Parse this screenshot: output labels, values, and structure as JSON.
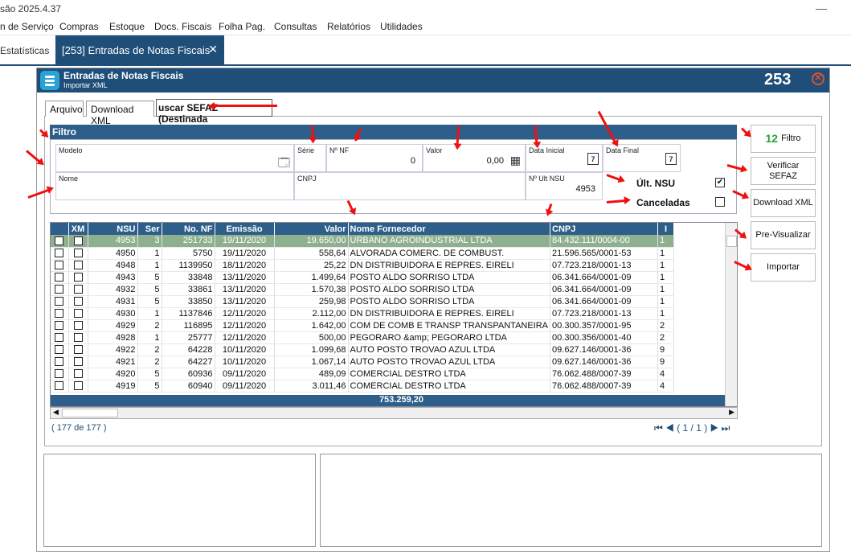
{
  "app": {
    "title_fragment": "são 2025.4.37",
    "minimize": "—"
  },
  "menu": [
    "n de Serviço",
    "Compras",
    "Estoque",
    "Docs. Fiscais",
    "Folha Pag.",
    "Consultas",
    "Relatórios",
    "Utilidades"
  ],
  "tabs": {
    "prev": "Estatísticas",
    "active": "[253] Entradas de Notas Fiscais",
    "close": "✕"
  },
  "window": {
    "title": "Entradas de Notas Fiscais",
    "subtitle": "Importar XML",
    "number": "253",
    "close": "✕"
  },
  "inner_tabs": [
    "Arquivo",
    "Download XML",
    "uscar SEFAZ (Destinada"
  ],
  "filtro": {
    "header": "Filtro",
    "modelo": {
      "label": "Modelo",
      "value": ""
    },
    "serie": {
      "label": "Série",
      "value": ""
    },
    "nnf": {
      "label": "Nº NF",
      "value": "0"
    },
    "valor": {
      "label": "Valor",
      "value": "0,00"
    },
    "data_inicial": {
      "label": "Data Inicial",
      "value": ""
    },
    "data_final": {
      "label": "Data Final",
      "value": ""
    },
    "nome": {
      "label": "Nome",
      "value": ""
    },
    "cnpj": {
      "label": "CNPJ",
      "value": ""
    },
    "ult_nsu": {
      "label": "Nº Ult NSU",
      "value": "4953"
    },
    "chk_ult_nsu": {
      "label": "Últ. NSU",
      "checked": true
    },
    "chk_canceladas": {
      "label": "Canceladas",
      "checked": false
    }
  },
  "buttons": {
    "filtro": "Filtro",
    "filtro_badge": "12",
    "verificar": "Verificar SEFAZ",
    "download": "Download XML",
    "previsualizar": "Pre-Visualizar",
    "importar": "Importar"
  },
  "grid": {
    "headers": [
      "",
      "XM",
      "NSU",
      "Ser",
      "No. NF",
      "Emissão",
      "Valor",
      "Nome Fornecedor",
      "CNPJ",
      "I"
    ],
    "rows": [
      {
        "nsu": "4953",
        "ser": "3",
        "nf": "251733",
        "emissao": "19/11/2020",
        "valor": "19.650,00",
        "fornecedor": "URBANO AGROINDUSTRIAL LTDA",
        "cnpj": "84.432.111/0004-00",
        "x": "1",
        "sel": true
      },
      {
        "nsu": "4950",
        "ser": "1",
        "nf": "5750",
        "emissao": "19/11/2020",
        "valor": "558,64",
        "fornecedor": "ALVORADA COMERC. DE COMBUST.",
        "cnpj": "21.596.565/0001-53",
        "x": "1"
      },
      {
        "nsu": "4948",
        "ser": "1",
        "nf": "1139950",
        "emissao": "18/11/2020",
        "valor": "25,22",
        "fornecedor": "DN DISTRIBUIDORA E REPRES. EIRELI",
        "cnpj": "07.723.218/0001-13",
        "x": "1"
      },
      {
        "nsu": "4943",
        "ser": "5",
        "nf": "33848",
        "emissao": "13/11/2020",
        "valor": "1.499,64",
        "fornecedor": "POSTO ALDO SORRISO LTDA",
        "cnpj": "06.341.664/0001-09",
        "x": "1"
      },
      {
        "nsu": "4932",
        "ser": "5",
        "nf": "33861",
        "emissao": "13/11/2020",
        "valor": "1.570,38",
        "fornecedor": "POSTO ALDO SORRISO LTDA",
        "cnpj": "06.341.664/0001-09",
        "x": "1"
      },
      {
        "nsu": "4931",
        "ser": "5",
        "nf": "33850",
        "emissao": "13/11/2020",
        "valor": "259,98",
        "fornecedor": "POSTO ALDO SORRISO LTDA",
        "cnpj": "06.341.664/0001-09",
        "x": "1"
      },
      {
        "nsu": "4930",
        "ser": "1",
        "nf": "1137846",
        "emissao": "12/11/2020",
        "valor": "2.112,00",
        "fornecedor": "DN DISTRIBUIDORA E REPRES. EIRELI",
        "cnpj": "07.723.218/0001-13",
        "x": "1"
      },
      {
        "nsu": "4929",
        "ser": "2",
        "nf": "116895",
        "emissao": "12/11/2020",
        "valor": "1.642,00",
        "fornecedor": "COM DE COMB E TRANSP TRANSPANTANEIRA",
        "cnpj": "00.300.357/0001-95",
        "x": "2"
      },
      {
        "nsu": "4928",
        "ser": "1",
        "nf": "25777",
        "emissao": "12/11/2020",
        "valor": "500,00",
        "fornecedor": "PEGORARO &amp; PEGORARO LTDA",
        "cnpj": "00.300.356/0001-40",
        "x": "2"
      },
      {
        "nsu": "4922",
        "ser": "2",
        "nf": "64228",
        "emissao": "10/11/2020",
        "valor": "1.099,68",
        "fornecedor": "AUTO POSTO TROVAO AZUL LTDA",
        "cnpj": "09.627.146/0001-36",
        "x": "9"
      },
      {
        "nsu": "4921",
        "ser": "2",
        "nf": "64227",
        "emissao": "10/11/2020",
        "valor": "1.067,14",
        "fornecedor": "AUTO POSTO TROVAO AZUL LTDA",
        "cnpj": "09.627.146/0001-36",
        "x": "9"
      },
      {
        "nsu": "4920",
        "ser": "5",
        "nf": "60936",
        "emissao": "09/11/2020",
        "valor": "489,09",
        "fornecedor": "COMERCIAL DESTRO LTDA",
        "cnpj": "76.062.488/0007-39",
        "x": "4"
      },
      {
        "nsu": "4919",
        "ser": "5",
        "nf": "60940",
        "emissao": "09/11/2020",
        "valor": "3.011,46",
        "fornecedor": "COMERCIAL DESTRO LTDA",
        "cnpj": "76.062.488/0007-39",
        "x": "4"
      }
    ],
    "total": "753.259,20"
  },
  "footer": {
    "count": "( 177 de 177 )",
    "page": "( 1 / 1 )"
  },
  "colors": {
    "primary": "#1f4e79",
    "header": "#2d5f8a",
    "selected": "#8fb08f",
    "arrow": "#ee1111"
  }
}
